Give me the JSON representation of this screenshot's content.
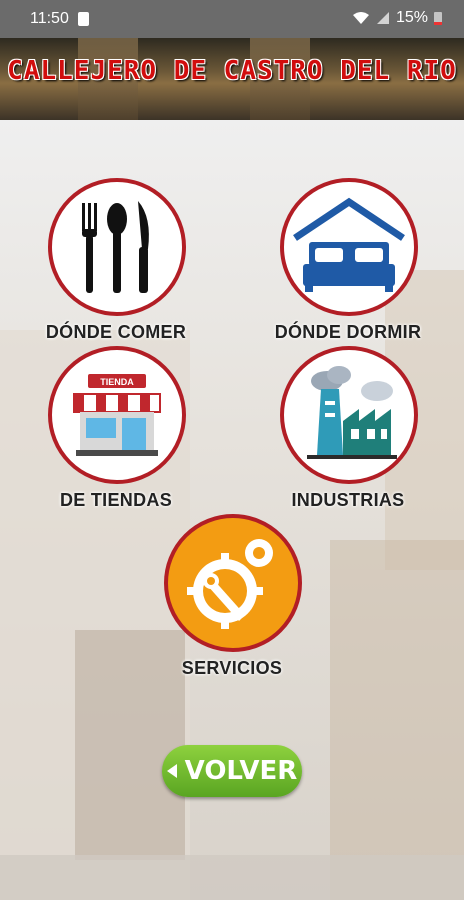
{
  "status_bar": {
    "time": "11:50",
    "battery": "15%"
  },
  "banner": {
    "title": "CALLEJERO DE CASTRO DEL RIO"
  },
  "menu": {
    "donde_comer": "DÓNDE COMER",
    "donde_dormir": "DÓNDE DORMIR",
    "de_tiendas": "DE TIENDAS",
    "tienda_sign": "TIENDA",
    "industrias": "INDUSTRIAS",
    "servicios": "SERVICIOS"
  },
  "volver_label": "VOLVER",
  "colors": {
    "accent_red": "#b21e25",
    "button_green": "#6cbc2c",
    "services_orange": "#f39c12",
    "title_red": "#d10d0d"
  }
}
